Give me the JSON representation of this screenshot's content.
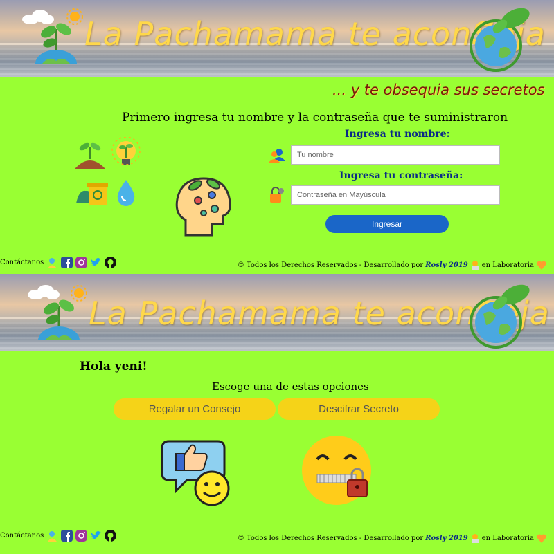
{
  "banner": {
    "title_prefix": "La Pachamama te acon",
    "title_emph": "S",
    "title_suffix": "eja"
  },
  "login": {
    "tagline": "... y te obsequia sus secretos",
    "instruction": "Primero ingresa tu nombre y la contraseña que te suministraron",
    "name_label": "Ingresa tu nombre:",
    "name_placeholder": "Tu nombre",
    "password_label": "Ingresa tu contraseña:",
    "password_placeholder": "Contraseña en Mayúscula",
    "submit_label": "Ingresar"
  },
  "footer": {
    "contact_label": "Contáctanos",
    "rights_text": "© Todos los Derechos Reservados - Desarrollado por",
    "author": "Rosly 2019",
    "suffix": "en Laboratoria"
  },
  "options": {
    "greeting": "Hola yeni!",
    "prompt": "Escoge una de estas opciones",
    "gift_label": "Regalar un Consejo",
    "decipher_label": "Descifrar Secreto"
  },
  "colors": {
    "background": "#99ff33",
    "banner_text": "#ffd84a",
    "label_text": "#0a2b86",
    "login_button": "#1a66c8",
    "option_button": "#f5d318"
  },
  "icons": [
    "cloud-icon",
    "sun-icon",
    "sprout-icon",
    "earth-icon",
    "leaf-icon",
    "user-icon",
    "lock-icon",
    "head-brain-icon",
    "compost-icon",
    "lightbulb-sprout-icon",
    "recycle-bin-icon",
    "water-drop-icon",
    "facebook-icon",
    "instagram-icon",
    "twitter-icon",
    "github-icon",
    "heart-icon",
    "thumbs-up-icon",
    "smiley-icon",
    "zipped-emoji-icon"
  ]
}
